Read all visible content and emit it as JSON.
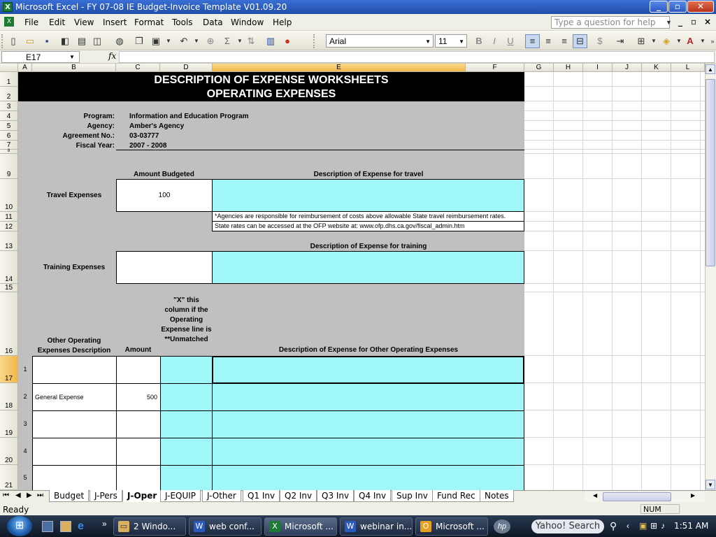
{
  "window": {
    "title": "Microsoft Excel - FY 07-08 IE Budget-Invoice Template V01.09.20",
    "app_icon": "excel-icon"
  },
  "menu": {
    "items": [
      "File",
      "Edit",
      "View",
      "Insert",
      "Format",
      "Tools",
      "Data",
      "Window",
      "Help"
    ],
    "help_placeholder": "Type a question for help"
  },
  "toolbar": {
    "font_name": "Arial",
    "font_size": "11",
    "bold": "B",
    "italic": "I",
    "underline": "U",
    "currency": "$",
    "percent": "%"
  },
  "formula_bar": {
    "name_box": "E17",
    "fx": "fx",
    "formula": ""
  },
  "columns": [
    "A",
    "B",
    "C",
    "D",
    "E",
    "F",
    "G",
    "H",
    "I",
    "J",
    "K",
    "L"
  ],
  "rows": [
    "1",
    "2",
    "3",
    "4",
    "5",
    "6",
    "7",
    "8",
    "9",
    "10",
    "11",
    "12",
    "13",
    "14",
    "15",
    "16",
    "17",
    "18",
    "19",
    "20",
    "21"
  ],
  "sheet": {
    "title1": "DESCRIPTION OF EXPENSE WORKSHEETS",
    "title2": "OPERATING EXPENSES",
    "program_label": "Program:",
    "program": "Information and Education Program",
    "agency_label": "Agency:",
    "agency": "Amber's Agency",
    "agreement_label": "Agreement No.:",
    "agreement": "03-03777",
    "fiscal_label": "Fiscal Year:",
    "fiscal": "2007 - 2008",
    "amount_budgeted_hdr": "Amount Budgeted",
    "travel_desc_hdr": "Description of Expense for travel",
    "travel_label": "Travel Expenses",
    "travel_amount": "100",
    "note1": "*Agencies are responsible for reimbursement of costs above allowable State travel reimbursement rates.",
    "note2": "State rates can be accessed at the OFP website at: www.ofp.dhs.ca.gov/fiscal_admin.htm",
    "training_desc_hdr": "Description of Expense for training",
    "training_label": "Training Expenses",
    "other_desc_hdr": "Other Operating Expenses Description",
    "amount_hdr": "Amount",
    "unmatched_hdr": "\"X\" this column if the Operating Expense line is **Unmatched",
    "other_desc_exp_hdr": "Description of Expense for Other Operating Expenses",
    "lines": [
      {
        "num": "1",
        "desc": "",
        "amount": ""
      },
      {
        "num": "2",
        "desc": "General Expense",
        "amount": "500"
      },
      {
        "num": "3",
        "desc": "",
        "amount": ""
      },
      {
        "num": "4",
        "desc": "",
        "amount": ""
      },
      {
        "num": "5",
        "desc": "",
        "amount": ""
      }
    ]
  },
  "tabs": [
    "Budget",
    "J-Pers",
    "J-Oper",
    "J-EQUIP",
    "J-Other",
    "Q1 Inv",
    "Q2 Inv",
    "Q3 Inv",
    "Q4 Inv",
    "Sup Inv",
    "Fund Rec",
    "Notes"
  ],
  "active_tab": "J-Oper",
  "status": {
    "left": "Ready",
    "num": "NUM"
  },
  "taskbar": {
    "items": [
      {
        "label": "2 Windo...",
        "icon": "folder-icon"
      },
      {
        "label": "web conf...",
        "icon": "word-icon"
      },
      {
        "label": "Microsoft ...",
        "icon": "excel-icon"
      },
      {
        "label": "webinar in...",
        "icon": "word-icon"
      },
      {
        "label": "Microsoft ...",
        "icon": "outlook-icon"
      }
    ],
    "search": "Yahoo! Search",
    "clock": "1:51 AM"
  }
}
